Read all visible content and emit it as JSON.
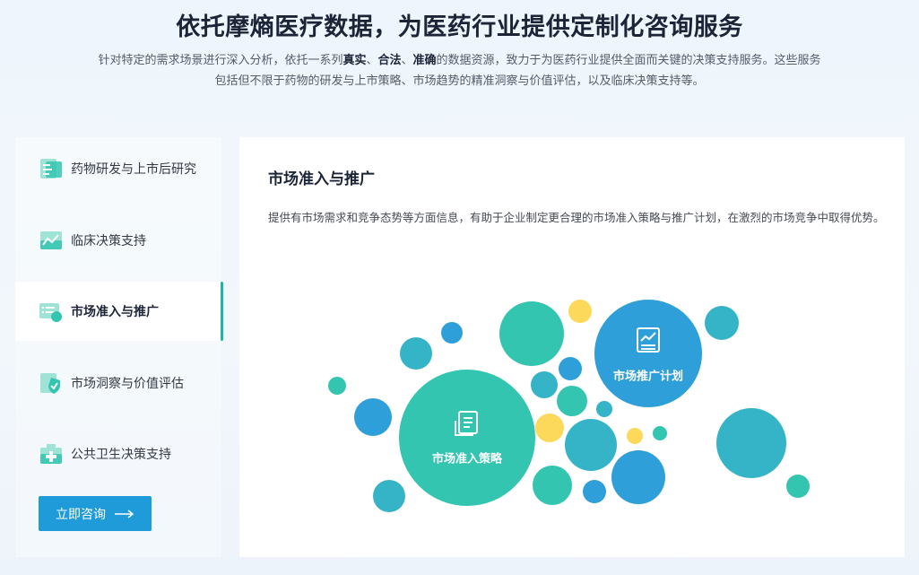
{
  "hero": {
    "title": "依托摩熵医疗数据，为医药行业提供定制化咨询服务",
    "desc_line1_pre": "针对特定的需求场景进行深入分析，依托一系列",
    "desc_bold1": "真实",
    "desc_sep1": "、",
    "desc_bold2": "合法",
    "desc_sep2": "、",
    "desc_bold3": "准确",
    "desc_line1_post": "的数据资源，致力于为医药行业提供全面而关键的决策支持服务。这些服务",
    "desc_line2": "包括但不限于药物的研发与上市策略、市场趋势的精准洞察与价值评估，以及临床决策支持等。"
  },
  "sidebar": {
    "items": [
      {
        "label": "药物研发与上市后研究",
        "icon": "document-list-icon",
        "active": false
      },
      {
        "label": "临床决策支持",
        "icon": "chart-trend-icon",
        "active": false
      },
      {
        "label": "市场准入与推广",
        "icon": "list-card-icon",
        "active": true
      },
      {
        "label": "市场洞察与价值评估",
        "icon": "shield-check-icon",
        "active": false
      },
      {
        "label": "公共卫生决策支持",
        "icon": "medical-kit-icon",
        "active": false
      }
    ],
    "cta_label": "立即咨询"
  },
  "main": {
    "title": "市场准入与推广",
    "text": "提供有市场需求和竞争态势等方面信息，有助于企业制定更合理的市场准入策略与推广计划，在激烈的市场竞争中取得优势。",
    "bubble_primary": "市场准入策略",
    "bubble_secondary": "市场推广计划"
  },
  "colors": {
    "teal": "#33c5b0",
    "teal_dark": "#35b4c7",
    "blue": "#2f9fd9",
    "yellow": "#fcd95a",
    "accent": "#20b5a8",
    "cta": "#1e9bd8"
  }
}
